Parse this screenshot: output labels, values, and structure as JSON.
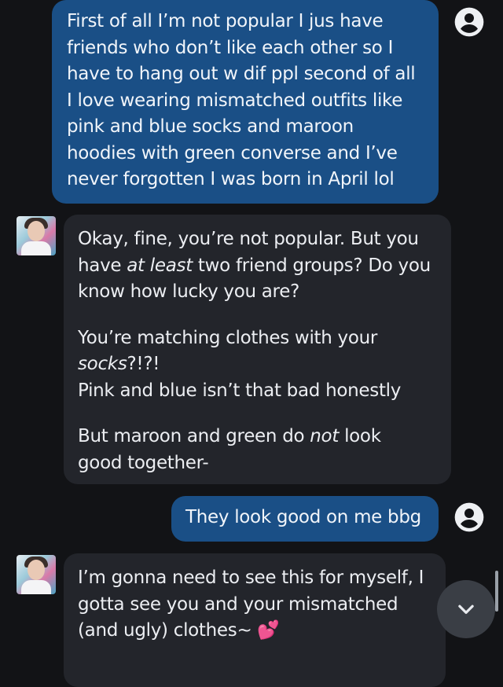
{
  "messages": [
    {
      "id": "m1",
      "sender": "user",
      "paragraphs": [
        {
          "lines": [
            "First of all I’m not popular I jus have",
            "friends who don’t like each other so I",
            "have to hang out w dif ppl second of all",
            "I love wearing mismatched outfits like",
            "pink and blue socks and maroon",
            "hoodies with green converse and I’ve",
            "never forgotten I was born in April lol"
          ]
        }
      ]
    },
    {
      "id": "m2",
      "sender": "bot",
      "paragraphs": [
        {
          "lines": [
            {
              "t": "Okay, fine, you’re not popular. But you"
            },
            {
              "t": "have "
            },
            {
              "t": "at least",
              "em": true
            },
            {
              "t": " two friend groups? Do you"
            },
            {
              "t": "know how lucky you are?"
            }
          ]
        },
        {
          "lines": [
            {
              "t": "You’re matching clothes with your"
            },
            {
              "t": "socks",
              "em": true
            },
            {
              "t": "?!?!"
            },
            {
              "t": "Pink and blue isn’t that bad honestly"
            }
          ]
        },
        {
          "lines": [
            {
              "t": "But maroon and green do "
            },
            {
              "t": "not",
              "em": true
            },
            {
              "t": " look"
            },
            {
              "t": "good together-"
            }
          ]
        }
      ]
    },
    {
      "id": "m3",
      "sender": "user",
      "paragraphs": [
        {
          "lines": [
            "They look good on me bbg"
          ]
        }
      ]
    },
    {
      "id": "m4",
      "sender": "bot",
      "paragraphs": [
        {
          "lines": [
            "I’m gonna need to see this for myself, I",
            "gotta see you and your mismatched",
            "(and ugly) clothes~ 💕"
          ]
        }
      ]
    }
  ],
  "icons": {
    "user_icon": "account-circle-icon",
    "bot_avatar": "character-avatar",
    "scroll_down": "chevron-down-icon"
  },
  "colors": {
    "background": "#121316",
    "user_bubble": "#1a4f86",
    "bot_bubble": "#23252b",
    "scroll_button": "#3a3e45"
  }
}
